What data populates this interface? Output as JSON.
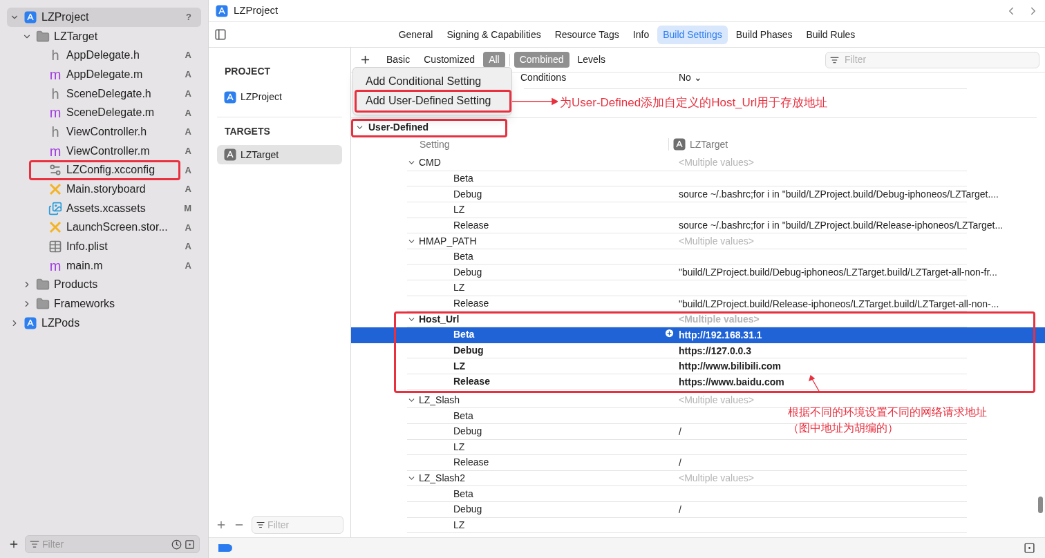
{
  "navigator": {
    "items": [
      {
        "label": "LZProject",
        "kind": "project",
        "badge": "?",
        "selected": true,
        "expanded": true,
        "children": [
          {
            "label": "LZTarget",
            "kind": "folder",
            "expanded": true,
            "selected": false,
            "children": [
              {
                "label": "AppDelegate.h",
                "kind": "header",
                "glyph": "h",
                "badge": "A",
                "selected": false,
                "highlighted": false
              },
              {
                "label": "AppDelegate.m",
                "kind": "source",
                "glyph": "m",
                "badge": "A",
                "selected": false,
                "highlighted": false
              },
              {
                "label": "SceneDelegate.h",
                "kind": "header",
                "glyph": "h",
                "badge": "A",
                "selected": false,
                "highlighted": false
              },
              {
                "label": "SceneDelegate.m",
                "kind": "source",
                "glyph": "m",
                "badge": "A",
                "selected": false,
                "highlighted": false
              },
              {
                "label": "ViewController.h",
                "kind": "header",
                "glyph": "h",
                "badge": "A",
                "selected": false,
                "highlighted": false
              },
              {
                "label": "ViewController.m",
                "kind": "source",
                "glyph": "m",
                "badge": "A",
                "selected": false,
                "highlighted": false
              },
              {
                "label": "LZConfig.xcconfig",
                "kind": "config",
                "badge": "A",
                "selected": false,
                "highlighted": true
              },
              {
                "label": "Main.storyboard",
                "kind": "storyboard",
                "badge": "A",
                "selected": false,
                "highlighted": false
              },
              {
                "label": "Assets.xcassets",
                "kind": "assets",
                "badge": "M",
                "selected": false,
                "highlighted": false
              },
              {
                "label": "LaunchScreen.stor...",
                "kind": "storyboard",
                "badge": "A",
                "selected": false,
                "highlighted": false
              },
              {
                "label": "Info.plist",
                "kind": "plist",
                "badge": "A",
                "selected": false,
                "highlighted": false
              },
              {
                "label": "main.m",
                "kind": "source",
                "glyph": "m",
                "badge": "A",
                "selected": false,
                "highlighted": false
              }
            ]
          },
          {
            "label": "Products",
            "kind": "folder",
            "expanded": false,
            "selected": false
          },
          {
            "label": "Frameworks",
            "kind": "folder",
            "expanded": false,
            "selected": false
          }
        ]
      },
      {
        "label": "LZPods",
        "kind": "project",
        "selected": false,
        "expanded": false
      }
    ],
    "filter": {
      "placeholder": "Filter"
    }
  },
  "editor": {
    "title": "LZProject",
    "tabs": [
      {
        "label": "General",
        "selected": false
      },
      {
        "label": "Signing & Capabilities",
        "selected": false
      },
      {
        "label": "Resource Tags",
        "selected": false
      },
      {
        "label": "Info",
        "selected": false
      },
      {
        "label": "Build Settings",
        "selected": true
      },
      {
        "label": "Build Phases",
        "selected": false
      },
      {
        "label": "Build Rules",
        "selected": false
      }
    ]
  },
  "targets_pane": {
    "project_heading": "PROJECT",
    "projects": [
      {
        "label": "LZProject",
        "selected": false
      }
    ],
    "targets_heading": "TARGETS",
    "targets": [
      {
        "label": "LZTarget",
        "selected": true
      }
    ],
    "filter": {
      "placeholder": "Filter"
    }
  },
  "toolbar": {
    "scopes": [
      {
        "label": "Basic",
        "selected": false
      },
      {
        "label": "Customized",
        "selected": false
      },
      {
        "label": "All",
        "selected": true
      }
    ],
    "views": [
      {
        "label": "Combined",
        "selected": true
      },
      {
        "label": "Levels",
        "selected": false
      }
    ],
    "filter": {
      "placeholder": "Filter"
    }
  },
  "menu": {
    "items": [
      {
        "label": "Add Conditional Setting",
        "highlighted": false
      },
      {
        "label": "Add User-Defined Setting",
        "highlighted": true
      }
    ]
  },
  "partial_row": {
    "name": "Conditions",
    "value": "No ⌄"
  },
  "section": {
    "title": "User-Defined",
    "expanded": true,
    "highlighted": true,
    "column_setting": "Setting",
    "column_target": "LZTarget",
    "groups": [
      {
        "name": "CMD",
        "value": "<Multiple values>",
        "bold": false,
        "highlighted": false,
        "rows": [
          {
            "name": "Beta",
            "value": "",
            "selected": false
          },
          {
            "name": "Debug",
            "value": "source ~/.bashrc;for i in \"build/LZProject.build/Debug-iphoneos/LZTarget....",
            "selected": false
          },
          {
            "name": "LZ",
            "value": "",
            "selected": false
          },
          {
            "name": "Release",
            "value": "source ~/.bashrc;for i in \"build/LZProject.build/Release-iphoneos/LZTarget...",
            "selected": false
          }
        ]
      },
      {
        "name": "HMAP_PATH",
        "value": "<Multiple values>",
        "bold": false,
        "highlighted": false,
        "rows": [
          {
            "name": "Beta",
            "value": "",
            "selected": false
          },
          {
            "name": "Debug",
            "value": "\"build/LZProject.build/Debug-iphoneos/LZTarget.build/LZTarget-all-non-fr...",
            "selected": false
          },
          {
            "name": "LZ",
            "value": "",
            "selected": false
          },
          {
            "name": "Release",
            "value": "\"build/LZProject.build/Release-iphoneos/LZTarget.build/LZTarget-all-non-...",
            "selected": false
          }
        ]
      },
      {
        "name": "Host_Url",
        "value": "<Multiple values>",
        "bold": true,
        "highlighted": true,
        "rows": [
          {
            "name": "Beta",
            "value": "http://192.168.31.1",
            "selected": true
          },
          {
            "name": "Debug",
            "value": "https://127.0.0.3",
            "selected": false
          },
          {
            "name": "LZ",
            "value": "http://www.bilibili.com",
            "selected": false
          },
          {
            "name": "Release",
            "value": "https://www.baidu.com",
            "selected": false
          }
        ]
      },
      {
        "name": "LZ_Slash",
        "value": "<Multiple values>",
        "bold": false,
        "highlighted": false,
        "rows": [
          {
            "name": "Beta",
            "value": "",
            "selected": false
          },
          {
            "name": "Debug",
            "value": "/",
            "selected": false
          },
          {
            "name": "LZ",
            "value": "",
            "selected": false
          },
          {
            "name": "Release",
            "value": "/",
            "selected": false
          }
        ]
      },
      {
        "name": "LZ_Slash2",
        "value": "<Multiple values>",
        "bold": false,
        "highlighted": false,
        "rows": [
          {
            "name": "Beta",
            "value": "",
            "selected": false
          },
          {
            "name": "Debug",
            "value": "/",
            "selected": false
          },
          {
            "name": "LZ",
            "value": "",
            "selected": false
          }
        ]
      }
    ]
  },
  "annotations": [
    {
      "lines": [
        "为User-Defined添加自定义的Host_Url用于存放地址"
      ]
    },
    {
      "lines": [
        "根据不同的环境设置不同的网络请求地址",
        "（图中地址为胡编的）"
      ]
    }
  ]
}
